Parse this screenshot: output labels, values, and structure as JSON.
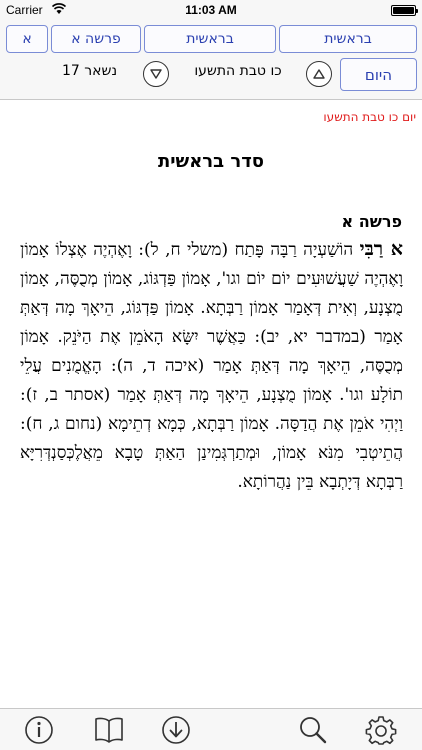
{
  "status_bar": {
    "carrier": "Carrier",
    "time": "11:03 AM"
  },
  "nav": {
    "letter": "א",
    "parsha": "פרשה א",
    "book": "בראשית",
    "sefer": "בראשית"
  },
  "day_nav": {
    "remaining": "נשאר 17",
    "date": "כו טבת התשעו",
    "today_label": "היום"
  },
  "content": {
    "day_line": "יום כו טבת התשעו",
    "seder_title": "סדר בראשית",
    "parasha_title": "פרשה א",
    "opening": "א רַבִּי",
    "body": "הוֹשַׁעְיָה רַבָּה פָּתַח (משלי ח, ל): וָאֶהְיֶה אֶצְלוֹ אָמוֹן וָאֶהְיֶה שַׁעֲשׁוּעִים יוֹם יוֹם וגו', אָמוֹן פַּדְגּוֹג, אָמוֹן מְכֻסֶּה, אָמוֹן מֻצְנָע, וְאִית דְּאָמַר אָמוֹן רַבְּתָא. אָמוֹן פַּדְגּוֹג, הֵיאָךְ מָה דְּאַתְּ אָמַר (במדבר יא, יב): כַּאֲשֶׁר יִשָּׂא הָאֹמֵן אֶת הַיֹּנֵק. אָמוֹן מְכֻסֶּה, הֵיאָךְ מָה דְּאַתְּ אָמַר (איכה ד, ה): הָאֱמֻנִים עֲלֵי תוֹלָע וגו'. אָמוֹן מֻצְנָע, הֵיאָךְ מָה דְּאַתְּ אָמַר (אסתר ב, ז): וַיְהִי אֹמֵן אֶת הֲדַסָּה. אָמוֹן רַבְּתָא, כְּמָא דְתֵימָא (נחום ג, ח): הֲתֵיטְבִי מִנֹּא אָמוֹן, וּמְתַרְגְּמִינַן הַאַתְּ טָבָא מֵאֲלֶכְּסַנְדְּרִיָּא רַבְּתָא דְּיָתְבָא בֵּין נַהֲרוֹתָא."
  },
  "toolbar": {
    "info_icon": "info-circle-icon",
    "book_icon": "open-book-icon",
    "download_icon": "download-circle-icon",
    "search_icon": "magnifier-icon",
    "settings_icon": "gear-icon"
  },
  "colors": {
    "accent": "#2a3fb0",
    "date_red": "#e01b1b"
  }
}
